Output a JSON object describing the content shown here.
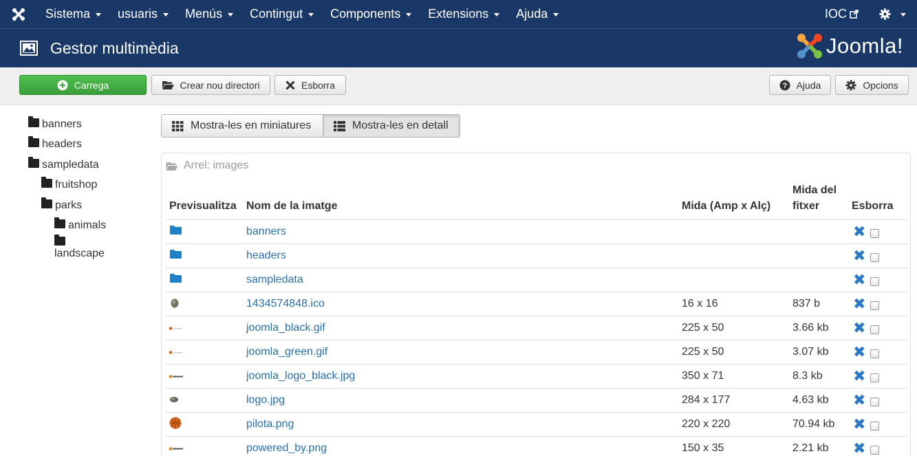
{
  "nav": {
    "items": [
      {
        "label": "Sistema"
      },
      {
        "label": "usuaris"
      },
      {
        "label": "Menús"
      },
      {
        "label": "Contingut"
      },
      {
        "label": "Components"
      },
      {
        "label": "Extensions"
      },
      {
        "label": "Ajuda"
      }
    ],
    "site_link": "IOC"
  },
  "header": {
    "title": "Gestor multimèdia",
    "brand": "Joomla!"
  },
  "toolbar": {
    "upload_label": "Carrega",
    "new_folder_label": "Crear nou directori",
    "delete_label": "Esborra",
    "help_label": "Ajuda",
    "options_label": "Opcions"
  },
  "tree": {
    "items": [
      {
        "label": "banners",
        "level": 0
      },
      {
        "label": "headers",
        "level": 0
      },
      {
        "label": "sampledata",
        "level": 0
      },
      {
        "label": "fruitshop",
        "level": 1
      },
      {
        "label": "parks",
        "level": 1
      },
      {
        "label": "animals",
        "level": 2
      },
      {
        "label": "landscape",
        "level": 2
      }
    ]
  },
  "view": {
    "thumbs_label": "Mostra-les en miniatures",
    "details_label": "Mostra-les en detall",
    "active": "details"
  },
  "breadcrumb": "Arrel: images",
  "table": {
    "headers": {
      "preview": "Previsualitza",
      "name": "Nom de la imatge",
      "dimensions": "Mida (Amp x Alç)",
      "size": "Mida del fitxer",
      "delete": "Esborra"
    },
    "rows": [
      {
        "type": "folder",
        "name": "banners",
        "dimensions": "",
        "size": ""
      },
      {
        "type": "folder",
        "name": "headers",
        "dimensions": "",
        "size": ""
      },
      {
        "type": "folder",
        "name": "sampledata",
        "dimensions": "",
        "size": ""
      },
      {
        "type": "stone",
        "name": "1434574848.ico",
        "dimensions": "16 x 16",
        "size": "837 b"
      },
      {
        "type": "logo-small",
        "name": "joomla_black.gif",
        "dimensions": "225 x 50",
        "size": "3.66 kb"
      },
      {
        "type": "logo-small",
        "name": "joomla_green.gif",
        "dimensions": "225 x 50",
        "size": "3.07 kb"
      },
      {
        "type": "logo-wide",
        "name": "joomla_logo_black.jpg",
        "dimensions": "350 x 71",
        "size": "8.3 kb"
      },
      {
        "type": "stone-small",
        "name": "logo.jpg",
        "dimensions": "284 x 177",
        "size": "4.63 kb"
      },
      {
        "type": "ball",
        "name": "pilota.png",
        "dimensions": "220 x 220",
        "size": "70.94 kb"
      },
      {
        "type": "logo-wide",
        "name": "powered_by.png",
        "dimensions": "150 x 35",
        "size": "2.21 kb"
      }
    ]
  },
  "colors": {
    "navbar": "#1a3867",
    "success": "#46a546",
    "link": "#2a6fa8",
    "folder_blue": "#1e82c8",
    "delete_x": "#2b78c5"
  }
}
